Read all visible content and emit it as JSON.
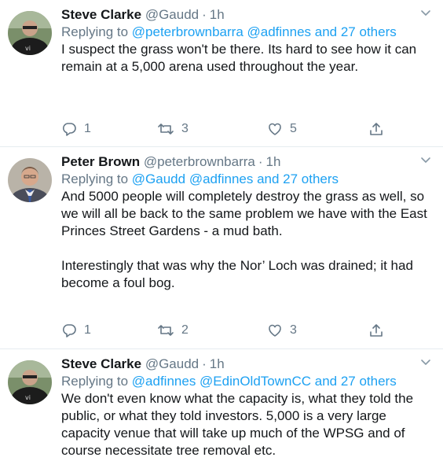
{
  "tweets": [
    {
      "name": "Steve Clarke",
      "handle": "@Gaudd",
      "time": "1h",
      "replying_prefix": "Replying to",
      "replying_to": "@peterbrownbarra @adfinnes and 27 others",
      "text": "I suspect the grass won't be there.  Its hard to  see how it can remain at a 5,000 arena used throughout the year.",
      "replies": "1",
      "retweets": "3",
      "likes": "5",
      "avatar_icon": "avatar-dark-shirt-sunglasses"
    },
    {
      "name": "Peter Brown",
      "handle": "@peterbrownbarra",
      "time": "1h",
      "replying_prefix": "Replying to",
      "replying_to": "@Gaudd @adfinnes and 27 others",
      "text": "And 5000 people will completely destroy the grass as well, so we will all be back to the same problem we have with the East Princes Street Gardens - a mud bath.\n\nInterestingly that was why the Nor’ Loch was drained; it had become a foul bog.",
      "replies": "1",
      "retweets": "2",
      "likes": "3",
      "avatar_icon": "avatar-man-suit-tie"
    },
    {
      "name": "Steve Clarke",
      "handle": "@Gaudd",
      "time": "1h",
      "replying_prefix": "Replying to",
      "replying_to": "@adfinnes @EdinOldTownCC and 27 others",
      "text": "We don't even know what the capacity is, what they told the public, or what they told investors.  5,000 is a very large capacity venue that will take up much of the WPSG and of course necessitate tree removal etc.",
      "avatar_icon": "avatar-dark-shirt-sunglasses"
    }
  ],
  "icons": {
    "reply": "speech-bubble-icon",
    "retweet": "retweet-arrows-icon",
    "like": "heart-icon",
    "share": "share-upload-icon",
    "menu": "chevron-down-icon"
  },
  "colors": {
    "link": "#1da1f2",
    "muted": "#657786",
    "divider": "#e6ecf0"
  }
}
